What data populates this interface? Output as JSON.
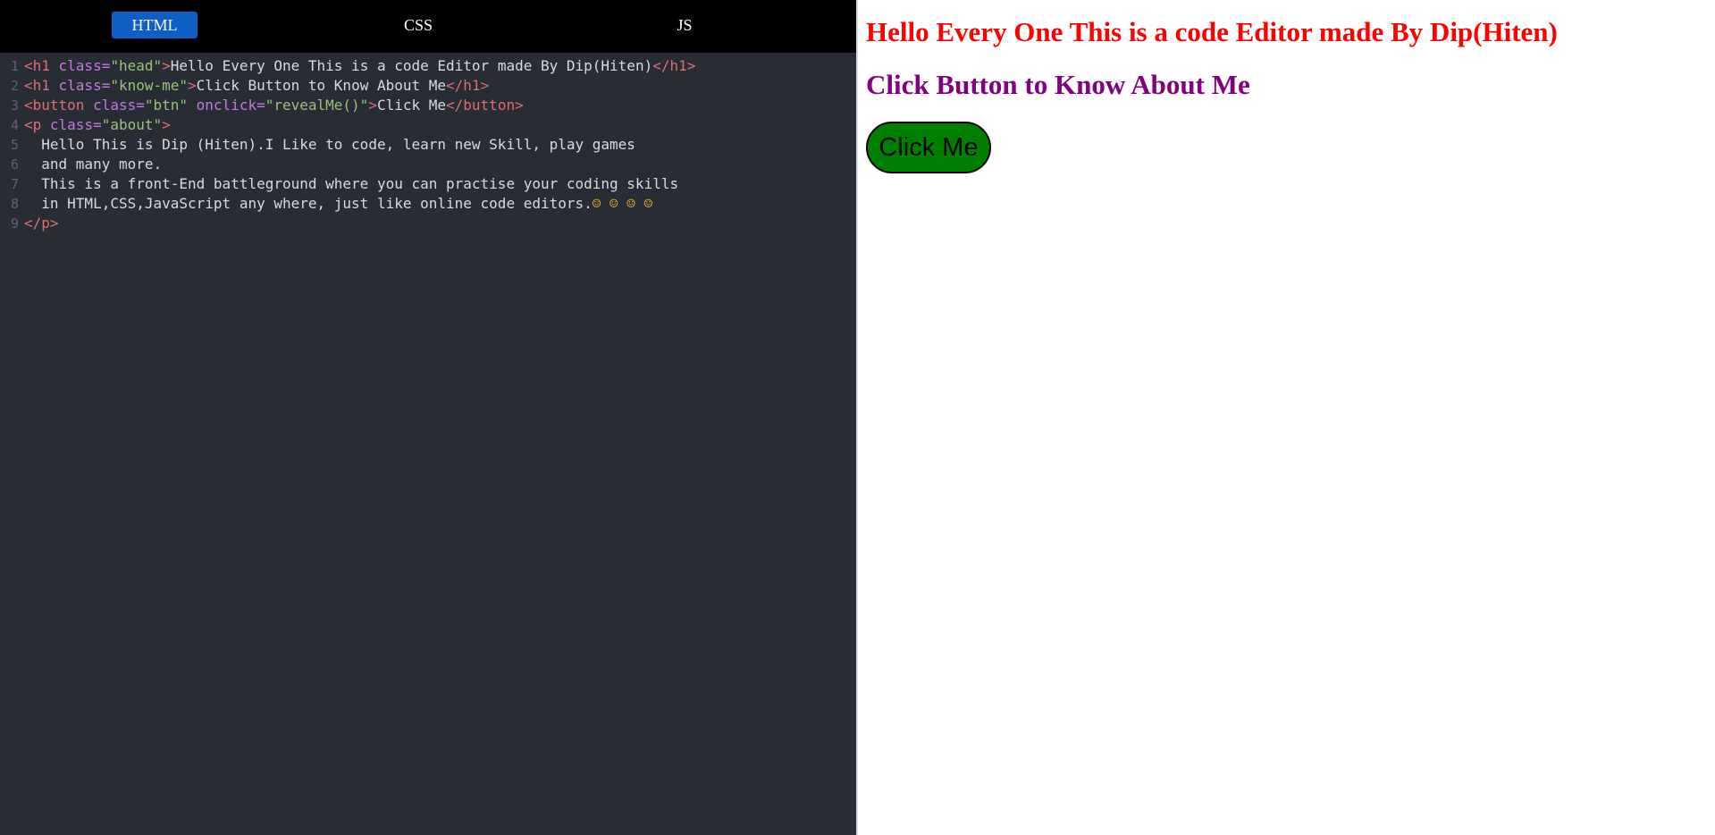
{
  "tabs": {
    "html_label": "HTML",
    "css_label": "CSS",
    "js_label": "JS",
    "active": "HTML"
  },
  "editor": {
    "lines": [
      {
        "num": "1",
        "tokens": [
          {
            "t": "tag",
            "v": "<h1 "
          },
          {
            "t": "attr",
            "v": "class="
          },
          {
            "t": "str",
            "v": "\"head\""
          },
          {
            "t": "tag",
            "v": ">"
          },
          {
            "t": "txt",
            "v": "Hello Every One This is a code Editor made By Dip(Hiten)"
          },
          {
            "t": "tag",
            "v": "</h1>"
          }
        ]
      },
      {
        "num": "2",
        "tokens": [
          {
            "t": "tag",
            "v": "<h1 "
          },
          {
            "t": "attr",
            "v": "class="
          },
          {
            "t": "str",
            "v": "\"know-me\""
          },
          {
            "t": "tag",
            "v": ">"
          },
          {
            "t": "txt",
            "v": "Click Button to Know About Me"
          },
          {
            "t": "tag",
            "v": "</h1>"
          }
        ]
      },
      {
        "num": "3",
        "tokens": [
          {
            "t": "tag",
            "v": "<button "
          },
          {
            "t": "attr",
            "v": "class="
          },
          {
            "t": "str",
            "v": "\"btn\" "
          },
          {
            "t": "attr",
            "v": "onclick="
          },
          {
            "t": "str",
            "v": "\"revealMe()\""
          },
          {
            "t": "tag",
            "v": ">"
          },
          {
            "t": "txt",
            "v": "Click Me"
          },
          {
            "t": "tag",
            "v": "</button>"
          }
        ]
      },
      {
        "num": "4",
        "tokens": [
          {
            "t": "tag",
            "v": "<p "
          },
          {
            "t": "attr",
            "v": "class="
          },
          {
            "t": "str",
            "v": "\"about\""
          },
          {
            "t": "tag",
            "v": ">"
          }
        ]
      },
      {
        "num": "5",
        "tokens": [
          {
            "t": "txt",
            "v": "  Hello This is Dip (Hiten).I Like to code, learn new Skill, play games"
          }
        ]
      },
      {
        "num": "6",
        "tokens": [
          {
            "t": "txt",
            "v": "  and many more."
          }
        ]
      },
      {
        "num": "7",
        "tokens": [
          {
            "t": "txt",
            "v": "  This is a front-End battleground where you can practise your coding skills"
          }
        ]
      },
      {
        "num": "8",
        "tokens": [
          {
            "t": "txt",
            "v": "  in HTML,CSS,JavaScript any where, just like online code editors."
          },
          {
            "t": "emoji",
            "v": "☺ ☺ ☺ ☺"
          }
        ]
      },
      {
        "num": "9",
        "tokens": [
          {
            "t": "tag",
            "v": "</p>"
          }
        ]
      }
    ]
  },
  "preview": {
    "head_text": "Hello Every One This is a code Editor made By Dip(Hiten)",
    "know_text": "Click Button to Know About Me",
    "button_label": "Click Me",
    "colors": {
      "head": "#ff0000",
      "know": "#800080",
      "button_bg": "#008000"
    }
  },
  "colors": {
    "editor_bg": "#282c34",
    "tabbar_bg": "#000000",
    "active_tab": "#0d5fc6",
    "tag": "#e06c75",
    "attr": "#c678dd",
    "string": "#98c379"
  }
}
